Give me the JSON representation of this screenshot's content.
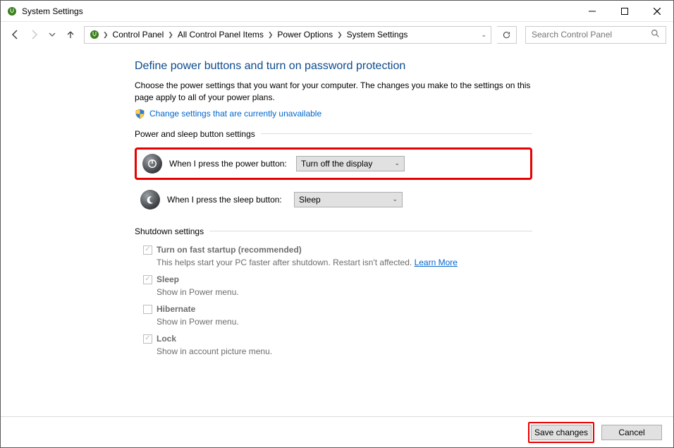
{
  "window": {
    "title": "System Settings"
  },
  "search": {
    "placeholder": "Search Control Panel"
  },
  "breadcrumbs": {
    "b0": "Control Panel",
    "b1": "All Control Panel Items",
    "b2": "Power Options",
    "b3": "System Settings"
  },
  "main": {
    "heading": "Define power buttons and turn on password protection",
    "intro": "Choose the power settings that you want for your computer. The changes you make to the settings on this page apply to all of your power plans.",
    "change_link": "Change settings that are currently unavailable",
    "section_buttons": "Power and sleep button settings",
    "power_button_label": "When I press the power button:",
    "power_button_value": "Turn off the display",
    "sleep_button_label": "When I press the sleep button:",
    "sleep_button_value": "Sleep",
    "section_shutdown": "Shutdown settings",
    "fast_startup_label": "Turn on fast startup (recommended)",
    "fast_startup_sub_a": "This helps start your PC faster after shutdown. Restart isn't affected. ",
    "fast_startup_learn": "Learn More",
    "sleep_label": "Sleep",
    "sleep_sub": "Show in Power menu.",
    "hibernate_label": "Hibernate",
    "hibernate_sub": "Show in Power menu.",
    "lock_label": "Lock",
    "lock_sub": "Show in account picture menu."
  },
  "footer": {
    "save": "Save changes",
    "cancel": "Cancel"
  }
}
